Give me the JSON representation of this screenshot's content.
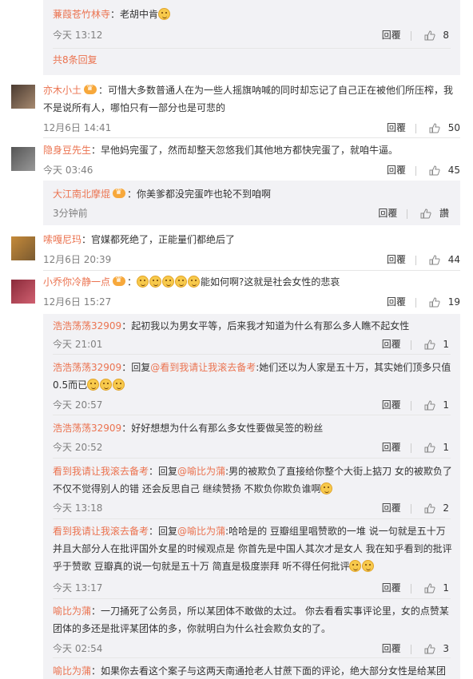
{
  "thread0": {
    "reply1": {
      "user": "蒹葭苍竹林寺",
      "text": "：老胡中肯",
      "time": "今天 13:12",
      "reply": "回覆",
      "likes": "8"
    },
    "more": "共8条回复"
  },
  "comments": [
    {
      "user": "亦木小土",
      "text": "：可惜大多数普通人在为一些人摇旗呐喊的同时却忘记了自己正在被他们所压榨，我不是说所有人，哪怕只有一部分也是可悲的",
      "time": "12月6日 14:41",
      "reply": "回覆",
      "likes": "50"
    },
    {
      "user": "隐身豆先生",
      "text": "：早他妈完蛋了，然而却整天忽悠我们其他地方都快完蛋了，就咱牛逼。",
      "time": "今天 03:46",
      "reply": "回覆",
      "likes": "45"
    },
    {
      "user": "嗦嘎尼玛",
      "text": "：官媒都死绝了，正能量们都绝后了",
      "time": "12月6日 20:39",
      "reply": "回覆",
      "likes": "44"
    },
    {
      "user": "小乔你冷静一点",
      "text": "能如何啊?这就是社会女性的悲哀",
      "time": "12月6日 15:27",
      "reply": "回覆",
      "likes": "19"
    }
  ],
  "sub2": {
    "user": "大江南北摩焜",
    "text": "：你美爹都没完蛋咋也轮不到咱啊",
    "time": "3分钟前",
    "reply": "回覆",
    "likes": "讚"
  },
  "sub5": [
    {
      "user": "浩浩荡荡32909",
      "text": "：起初我以为男女平等，后来我才知道为什么有那么多人瞧不起女性",
      "time": "今天 21:01",
      "reply": "回覆",
      "likes": "1"
    },
    {
      "user": "浩浩荡荡32909",
      "pre": "：回复",
      "at": "@看到我请让我滚去备考",
      "text": ":她们还以为人家是五十万，其实她们顶多只值0.5而已",
      "time": "今天 20:57",
      "reply": "回覆",
      "likes": "1"
    },
    {
      "user": "浩浩荡荡32909",
      "text": "：好好想想为什么有那么多女性要做吴签的粉丝",
      "time": "今天 20:52",
      "reply": "回覆",
      "likes": "1"
    },
    {
      "user": "看到我请让我滚去备考",
      "pre": "：回复",
      "at": "@喻比为蒲",
      "text": ":男的被欺负了直接给你整个大街上掂刀 女的被欺负了 不仅不觉得别人的错 还会反思自己 继续赞扬 不欺负你欺负谁啊",
      "time": "今天 13:18",
      "reply": "回覆",
      "likes": "2"
    },
    {
      "user": "看到我请让我滚去备考",
      "pre": "：回复",
      "at": "@喻比为蒲",
      "text": ":哈哈是的 豆瓣组里唱赞歌的一堆 说一句就是五十万 并且大部分人在批评国外女星的时候观点是 你首先是中国人其次才是女人 我在知乎看到的批评乎于赞歌 豆瓣真的说一句就是五十万 简直是极度崇拜 听不得任何批评",
      "time": "今天 13:17",
      "reply": "回覆",
      "likes": "1"
    },
    {
      "user": "喻比为蒲",
      "text": "：一刀捅死了公务员，所以某团体不敢做的太过。 你去看看实事评论里，女的点赞某团体的多还是批评某团体的多，你就明白为什么社会欺负女的了。",
      "time": "今天 02:54",
      "reply": "回覆",
      "likes": "3"
    },
    {
      "user": "喻比为蒲",
      "text": "：如果你去看这个案子与这两天南通抢老人甘蔗下面的评论，绝大部分女性是给某团"
    }
  ]
}
